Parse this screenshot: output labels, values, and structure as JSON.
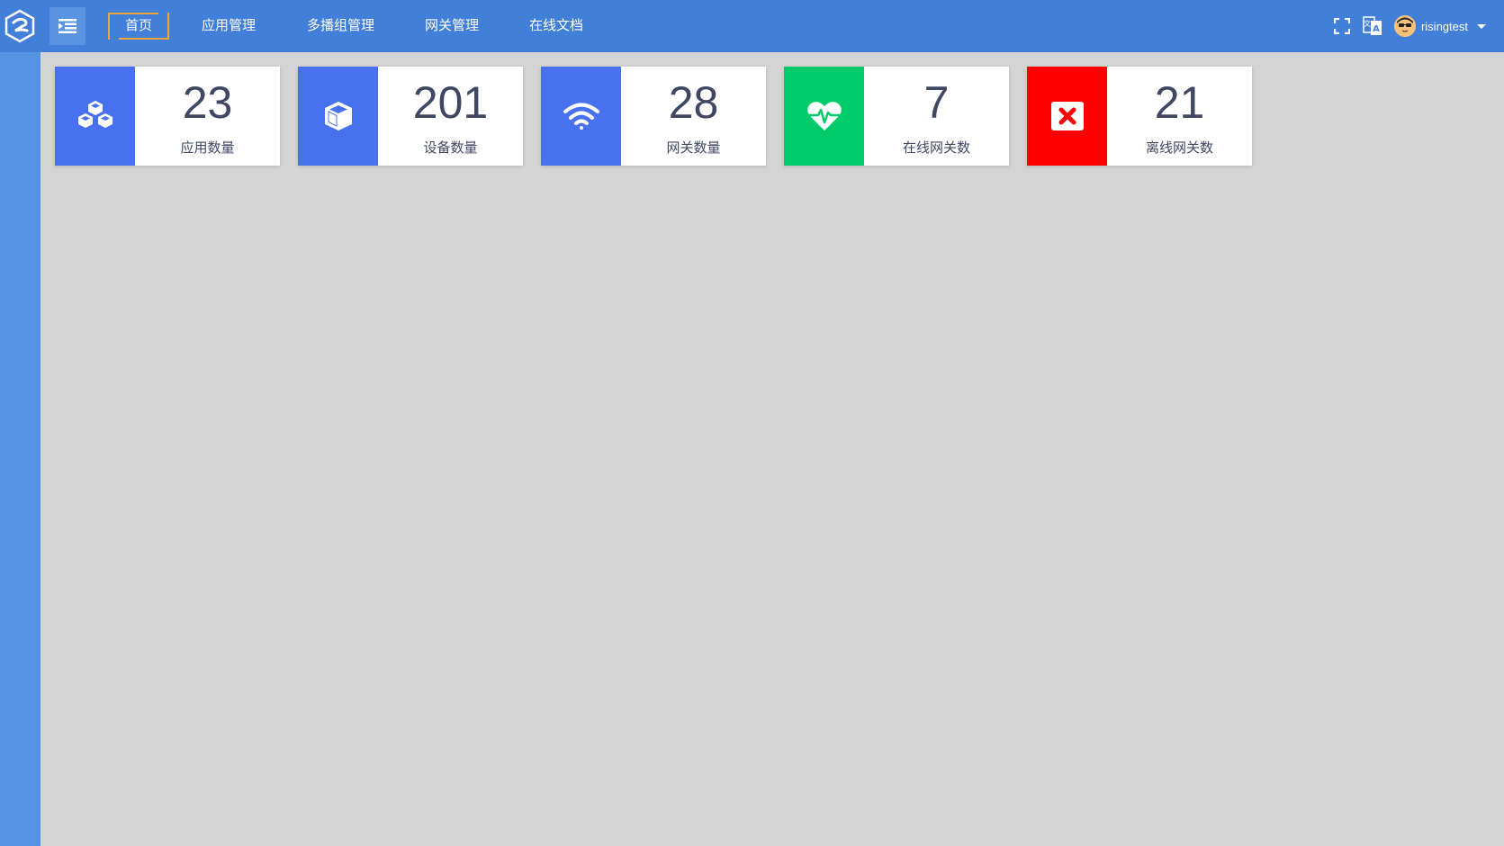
{
  "colors": {
    "topbar": "#417fd8",
    "sidebar": "#5593e3",
    "background": "#d4d4d4",
    "active_border": "#f0a53a",
    "card_text": "#3f4763"
  },
  "nav": {
    "items": [
      {
        "label": "首页",
        "active": true
      },
      {
        "label": "应用管理",
        "active": false
      },
      {
        "label": "多播组管理",
        "active": false
      },
      {
        "label": "网关管理",
        "active": false
      },
      {
        "label": "在线文档",
        "active": false
      }
    ]
  },
  "header": {
    "fullscreen_icon": "fullscreen-icon",
    "language_icon": "translate-icon",
    "username": "risingtest"
  },
  "stats": [
    {
      "value": "23",
      "label": "应用数量",
      "icon": "cubes-icon",
      "color": "#4871ef"
    },
    {
      "value": "201",
      "label": "设备数量",
      "icon": "cube-icon",
      "color": "#4871ef"
    },
    {
      "value": "28",
      "label": "网关数量",
      "icon": "wifi-icon",
      "color": "#4871ef"
    },
    {
      "value": "7",
      "label": "在线网关数",
      "icon": "heartbeat-icon",
      "color": "#00cb6a"
    },
    {
      "value": "21",
      "label": "离线网关数",
      "icon": "close-box-icon",
      "color": "#ff0000"
    }
  ]
}
